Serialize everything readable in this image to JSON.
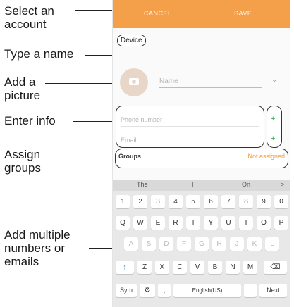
{
  "callouts": {
    "select_account": [
      "Select an",
      "account"
    ],
    "type_name": "Type a name",
    "add_picture": [
      "Add a",
      "picture"
    ],
    "enter_info": "Enter info",
    "assign_groups": [
      "Assign",
      "groups"
    ],
    "add_multiple": [
      "Add multiple",
      "numbers or",
      "emails"
    ]
  },
  "topbar": {
    "cancel": "CANCEL",
    "save": "SAVE",
    "color": "#f4a04b"
  },
  "form": {
    "account": "Device",
    "name_placeholder": "Name",
    "phone_placeholder": "Phone number",
    "email_placeholder": "Email",
    "plus_symbol": "+",
    "groups_label": "Groups",
    "groups_value": "Not assigned"
  },
  "keyboard": {
    "suggestions": [
      "The",
      "I",
      "On"
    ],
    "suggest_arrow": ">",
    "row1": [
      "1",
      "2",
      "3",
      "4",
      "5",
      "6",
      "7",
      "8",
      "9",
      "0"
    ],
    "row2": [
      "Q",
      "W",
      "E",
      "R",
      "T",
      "Y",
      "U",
      "I",
      "O",
      "P"
    ],
    "row3": [
      "A",
      "S",
      "D",
      "F",
      "G",
      "H",
      "J",
      "K",
      "L"
    ],
    "row4": [
      "↑",
      "Z",
      "X",
      "C",
      "V",
      "B",
      "N",
      "M",
      "⌫"
    ],
    "row5": [
      "Sym",
      "⚙",
      ",",
      "English(US)",
      ".",
      "Next"
    ]
  }
}
